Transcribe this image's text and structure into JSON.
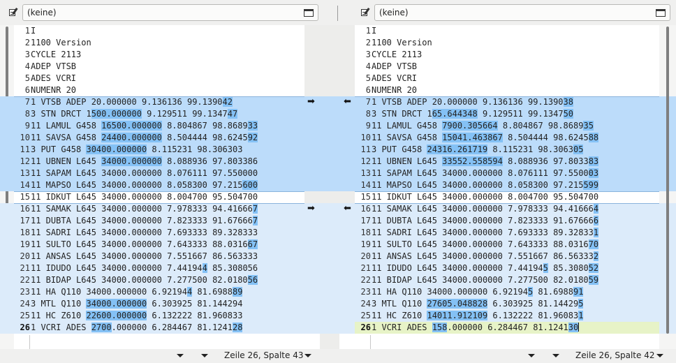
{
  "left_panel": {
    "file_label": "(keine)",
    "status": "Zeile 26, Spalte 43"
  },
  "right_panel": {
    "file_label": "(keine)",
    "status": "Zeile 26, Spalte 42"
  },
  "arrows": {
    "copy_right": "➡",
    "copy_left": "⬅"
  },
  "left_lines": [
    {
      "n": "1",
      "parts": [
        [
          "I",
          ""
        ]
      ]
    },
    {
      "n": "2",
      "parts": [
        [
          "1100 Version",
          ""
        ]
      ]
    },
    {
      "n": "3",
      "parts": [
        [
          "CYCLE 2113",
          ""
        ]
      ]
    },
    {
      "n": "4",
      "parts": [
        [
          "ADEP VTSB",
          ""
        ]
      ]
    },
    {
      "n": "5",
      "parts": [
        [
          "ADES VCRI",
          ""
        ]
      ]
    },
    {
      "n": "6",
      "parts": [
        [
          "NUMENR 20",
          ""
        ]
      ]
    },
    {
      "n": "7",
      "parts": [
        [
          "1 VTSB ADEP 20.000000 9.136136 99.1390",
          ""
        ],
        [
          "42",
          "hl"
        ]
      ]
    },
    {
      "n": "8",
      "parts": [
        [
          "3 STN DRCT 1",
          ""
        ],
        [
          "500.000000",
          "hl"
        ],
        [
          " 9.129511 99.1347",
          ""
        ],
        [
          "47",
          "hl"
        ]
      ]
    },
    {
      "n": "9",
      "parts": [
        [
          "11 LAMUL G458 ",
          ""
        ],
        [
          "16500.000000",
          "hl"
        ],
        [
          " 8.804867 98.8689",
          ""
        ],
        [
          "33",
          "hl"
        ]
      ]
    },
    {
      "n": "10",
      "parts": [
        [
          "11 SAVSA G458 ",
          ""
        ],
        [
          "24400.000000",
          "hl"
        ],
        [
          " 8.504444 98.6245",
          ""
        ],
        [
          "92",
          "hl"
        ]
      ]
    },
    {
      "n": "11",
      "parts": [
        [
          "3 PUT G458 ",
          ""
        ],
        [
          "30400.000000",
          "hl"
        ],
        [
          " 8.115231 98.306303",
          ""
        ]
      ]
    },
    {
      "n": "12",
      "parts": [
        [
          "11 UBNEN L645 ",
          ""
        ],
        [
          "34000.000000",
          "hl"
        ],
        [
          " 8.088936 97.803386",
          ""
        ]
      ]
    },
    {
      "n": "13",
      "parts": [
        [
          "11 SAPAM L645 34000.000000 8.076111 97.550000",
          ""
        ]
      ]
    },
    {
      "n": "14",
      "parts": [
        [
          "11 MAPSO L645 34000.000000 8.058300 97.215",
          ""
        ],
        [
          "600",
          "hl"
        ]
      ]
    },
    {
      "n": "15",
      "parts": [
        [
          "11 IDKUT L645 34000.000000 8.004700 95.504700",
          ""
        ]
      ]
    },
    {
      "n": "16",
      "parts": [
        [
          "11 SAMAK L645 34000.000000 7.978333 94.41666",
          ""
        ],
        [
          "7",
          "hl"
        ]
      ]
    },
    {
      "n": "17",
      "parts": [
        [
          "11 DUBTA L645 34000.000000 7.823333 91.67666",
          ""
        ],
        [
          "7",
          "hl"
        ]
      ]
    },
    {
      "n": "18",
      "parts": [
        [
          "11 SADRI L645 34000.000000 7.693333 89.328333",
          ""
        ]
      ]
    },
    {
      "n": "19",
      "parts": [
        [
          "11 SULTO L645 34000.000000 7.643333 88.0316",
          ""
        ],
        [
          "67",
          "hl"
        ]
      ]
    },
    {
      "n": "20",
      "parts": [
        [
          "11 ANSAS L645 34000.000000 7.551667 86.563333",
          ""
        ]
      ]
    },
    {
      "n": "21",
      "parts": [
        [
          "11 IDUDO L645 34000.000000 7.44194",
          ""
        ],
        [
          "4",
          "hl"
        ],
        [
          " 85.308056",
          ""
        ]
      ]
    },
    {
      "n": "22",
      "parts": [
        [
          "11 BIDAP L645 34000.000000 7.277500 82.0180",
          ""
        ],
        [
          "56",
          "hl"
        ]
      ]
    },
    {
      "n": "23",
      "parts": [
        [
          "11 HA Q110 34000.000000 6.92194",
          ""
        ],
        [
          "4",
          "hl"
        ],
        [
          " 81.6988",
          ""
        ],
        [
          "89",
          "hl"
        ]
      ]
    },
    {
      "n": "24",
      "parts": [
        [
          "3 MTL Q110 ",
          ""
        ],
        [
          "34000.000000",
          "hl"
        ],
        [
          " 6.303925 81.144294",
          ""
        ]
      ]
    },
    {
      "n": "25",
      "parts": [
        [
          "11 HC Z610 ",
          ""
        ],
        [
          "22600.000000",
          "hl"
        ],
        [
          " 6.132222 81.960833",
          ""
        ]
      ]
    },
    {
      "n": "26",
      "parts": [
        [
          "1 VCRI ADES ",
          ""
        ],
        [
          "2700",
          "hl"
        ],
        [
          ".000000 6.284467 81.1241",
          ""
        ],
        [
          "28",
          "hl"
        ]
      ]
    }
  ],
  "right_lines": [
    {
      "n": "1",
      "parts": [
        [
          "I",
          ""
        ]
      ]
    },
    {
      "n": "2",
      "parts": [
        [
          "1100 Version",
          ""
        ]
      ]
    },
    {
      "n": "3",
      "parts": [
        [
          "CYCLE 2113",
          ""
        ]
      ]
    },
    {
      "n": "4",
      "parts": [
        [
          "ADEP VTSB",
          ""
        ]
      ]
    },
    {
      "n": "5",
      "parts": [
        [
          "ADES VCRI",
          ""
        ]
      ]
    },
    {
      "n": "6",
      "parts": [
        [
          "NUMENR 20",
          ""
        ]
      ]
    },
    {
      "n": "7",
      "parts": [
        [
          "1 VTSB ADEP 20.000000 9.136136 99.1390",
          ""
        ],
        [
          "38",
          "hl"
        ]
      ]
    },
    {
      "n": "8",
      "parts": [
        [
          "3 STN DRCT 1",
          ""
        ],
        [
          "65.644348",
          "hl"
        ],
        [
          " 9.129511 99.1347",
          ""
        ],
        [
          "50",
          "hl"
        ]
      ]
    },
    {
      "n": "9",
      "parts": [
        [
          "11 LAMUL G458 ",
          ""
        ],
        [
          "7900.305664",
          "hl"
        ],
        [
          " 8.804867 98.8689",
          ""
        ],
        [
          "35",
          "hl"
        ]
      ]
    },
    {
      "n": "10",
      "parts": [
        [
          "11 SAVSA G458 ",
          ""
        ],
        [
          "15041.463867",
          "hl"
        ],
        [
          " 8.504444 98.6245",
          ""
        ],
        [
          "88",
          "hl"
        ]
      ]
    },
    {
      "n": "11",
      "parts": [
        [
          "3 PUT G458 ",
          ""
        ],
        [
          "24316.261719",
          "hl"
        ],
        [
          " 8.115231 98.3063",
          ""
        ],
        [
          "05",
          "hl"
        ]
      ]
    },
    {
      "n": "12",
      "parts": [
        [
          "11 UBNEN L645 ",
          ""
        ],
        [
          "33552.558594",
          "hl"
        ],
        [
          " 8.088936 97.8033",
          ""
        ],
        [
          "83",
          "hl"
        ]
      ]
    },
    {
      "n": "13",
      "parts": [
        [
          "11 SAPAM L645 34000.000000 8.076111 97.5500",
          ""
        ],
        [
          "03",
          "hl"
        ]
      ]
    },
    {
      "n": "14",
      "parts": [
        [
          "11 MAPSO L645 34000.000000 8.058300 97.215",
          ""
        ],
        [
          "599",
          "hl"
        ]
      ]
    },
    {
      "n": "15",
      "parts": [
        [
          "11 IDKUT L645 34000.000000 8.004700 95.504700",
          ""
        ]
      ]
    },
    {
      "n": "16",
      "parts": [
        [
          "11 SAMAK L645 34000.000000 7.978333 94.41666",
          ""
        ],
        [
          "4",
          "hl"
        ]
      ]
    },
    {
      "n": "17",
      "parts": [
        [
          "11 DUBTA L645 34000.000000 7.823333 91.67666",
          ""
        ],
        [
          "6",
          "hl"
        ]
      ]
    },
    {
      "n": "18",
      "parts": [
        [
          "11 SADRI L645 34000.000000 7.693333 89.32833",
          ""
        ],
        [
          "1",
          "hl"
        ]
      ]
    },
    {
      "n": "19",
      "parts": [
        [
          "11 SULTO L645 34000.000000 7.643333 88.0316",
          ""
        ],
        [
          "70",
          "hl"
        ]
      ]
    },
    {
      "n": "20",
      "parts": [
        [
          "11 ANSAS L645 34000.000000 7.551667 86.56333",
          ""
        ],
        [
          "2",
          "hl"
        ]
      ]
    },
    {
      "n": "21",
      "parts": [
        [
          "11 IDUDO L645 34000.000000 7.44194",
          ""
        ],
        [
          "5",
          "hl"
        ],
        [
          " 85.3080",
          ""
        ],
        [
          "52",
          "hl"
        ]
      ]
    },
    {
      "n": "22",
      "parts": [
        [
          "11 BIDAP L645 34000.000000 7.277500 82.0180",
          ""
        ],
        [
          "59",
          "hl"
        ]
      ]
    },
    {
      "n": "23",
      "parts": [
        [
          "11 HA Q110 34000.000000 6.92194",
          ""
        ],
        [
          "5",
          "hl"
        ],
        [
          " 81.6988",
          ""
        ],
        [
          "91",
          "hl"
        ]
      ]
    },
    {
      "n": "24",
      "parts": [
        [
          "3 MTL Q110 ",
          ""
        ],
        [
          "27605.048828",
          "hl"
        ],
        [
          " 6.303925 81.14429",
          ""
        ],
        [
          "5",
          "hl"
        ]
      ]
    },
    {
      "n": "25",
      "parts": [
        [
          "11 HC Z610 ",
          ""
        ],
        [
          "14011.912109",
          "hl"
        ],
        [
          " 6.132222 81.96083",
          ""
        ],
        [
          "1",
          "hl"
        ]
      ]
    },
    {
      "n": "26",
      "parts": [
        [
          "1 VCRI ADES ",
          ""
        ],
        [
          "158",
          "hl"
        ],
        [
          ".000000 6.284467 81.1241",
          ""
        ],
        [
          "30",
          "hl"
        ]
      ]
    }
  ],
  "colors": {
    "changed_block": "#bcdcfa",
    "changed_block_light": "#dcebfa",
    "char_highlight": "#84c1f5",
    "current_line": "#e7f3c7"
  }
}
